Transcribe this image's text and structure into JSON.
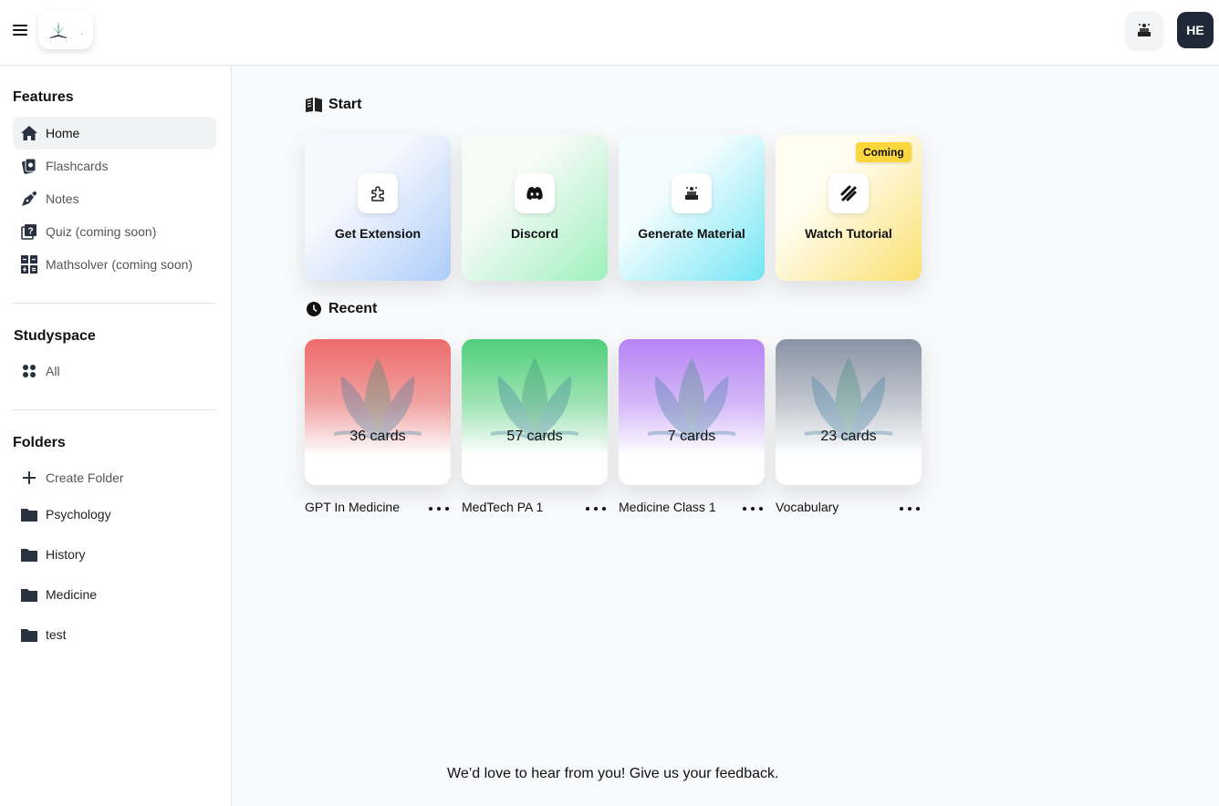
{
  "header": {
    "menu_icon": "hamburger-menu-icon",
    "logo_icon": "plant-book-logo-icon",
    "logo_text": "·",
    "action_icon": "study-desk-icon",
    "avatar_initials": "HE"
  },
  "sidebar": {
    "features_title": "Features",
    "features": [
      {
        "label": "Home",
        "icon": "home-icon",
        "active": true
      },
      {
        "label": "Flashcards",
        "icon": "flashcards-icon"
      },
      {
        "label": "Notes",
        "icon": "pen-nib-icon"
      },
      {
        "label": "Quiz (coming soon)",
        "icon": "quiz-icon"
      },
      {
        "label": "Mathsolver (coming soon)",
        "icon": "calculator-icon"
      }
    ],
    "studyspace_title": "Studyspace",
    "studyspace": [
      {
        "label": "All",
        "icon": "grid-icon"
      }
    ],
    "folders_title": "Folders",
    "create_folder": "Create Folder",
    "folders": [
      {
        "label": "Psychology",
        "icon": "folder-icon"
      },
      {
        "label": "History",
        "icon": "folder-icon"
      },
      {
        "label": "Medicine",
        "icon": "folder-icon"
      },
      {
        "label": "test",
        "icon": "folder-icon"
      }
    ]
  },
  "main": {
    "start_title": "Start",
    "start_icon": "book-icon",
    "start_cards": [
      {
        "label": "Get Extension",
        "icon": "puzzle-icon",
        "colors": [
          "#f6f8fd",
          "#aecdfa"
        ]
      },
      {
        "label": "Discord",
        "icon": "discord-icon",
        "colors": [
          "#f6fbf7",
          "#9ef0bd"
        ]
      },
      {
        "label": "Generate Material",
        "icon": "study-desk-icon",
        "colors": [
          "#f4fdfe",
          "#74e6f5"
        ]
      },
      {
        "label": "Watch Tutorial",
        "icon": "slashes-icon",
        "colors": [
          "#fffdf0",
          "#fbe070"
        ],
        "badge": "Coming"
      }
    ],
    "recent_title": "Recent",
    "recent_icon": "clock-icon",
    "recent_cards": [
      {
        "title": "GPT In Medicine",
        "count": "36 cards",
        "color": "#ee6b6b"
      },
      {
        "title": "MedTech PA 1",
        "count": "57 cards",
        "color": "#4fcf7a"
      },
      {
        "title": "Medicine Class 1",
        "count": "7 cards",
        "color": "#b784f5"
      },
      {
        "title": "Vocabulary",
        "count": "23 cards",
        "color": "#8993a3"
      }
    ],
    "feedback": "We’d love to hear from you! Give us your feedback."
  }
}
